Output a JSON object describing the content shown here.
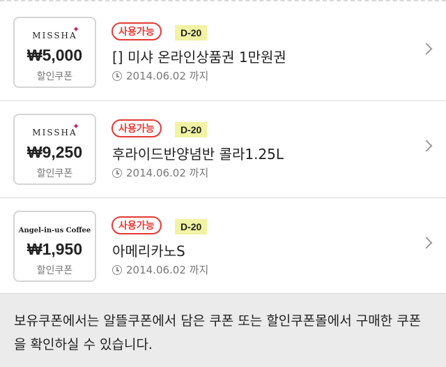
{
  "coupons": [
    {
      "brand": "MISSHA",
      "brand_mark": "✦",
      "price": "₩5,000",
      "thumb_sub": "할인쿠폰",
      "status": "사용가능",
      "dday": "D-20",
      "title": "[] 미샤 온라인상품권 1만원권",
      "expiry": "2014.06.02 까지"
    },
    {
      "brand": "MISSHA",
      "brand_mark": "✦",
      "price": "₩9,250",
      "thumb_sub": "할인쿠폰",
      "status": "사용가능",
      "dday": "D-20",
      "title": "후라이드반양념반 콜라1.25L",
      "expiry": "2014.06.02 까지"
    },
    {
      "brand": "Angel-in-us Coffee",
      "price": "₩1,950",
      "thumb_sub": "할인쿠폰",
      "status": "사용가능",
      "dday": "D-20",
      "title": "아메리카노S",
      "expiry": "2014.06.02 까지"
    }
  ],
  "notice": "보유쿠폰에서는 알뜰쿠폰에서 담은 쿠폰 또는 할인쿠폰몰에서 구매한 쿠폰을 확인하실 수 있습니다.",
  "colors": {
    "status_red": "#e53935",
    "dday_bg": "#f1f2a3",
    "notice_bg": "#ebebeb"
  }
}
